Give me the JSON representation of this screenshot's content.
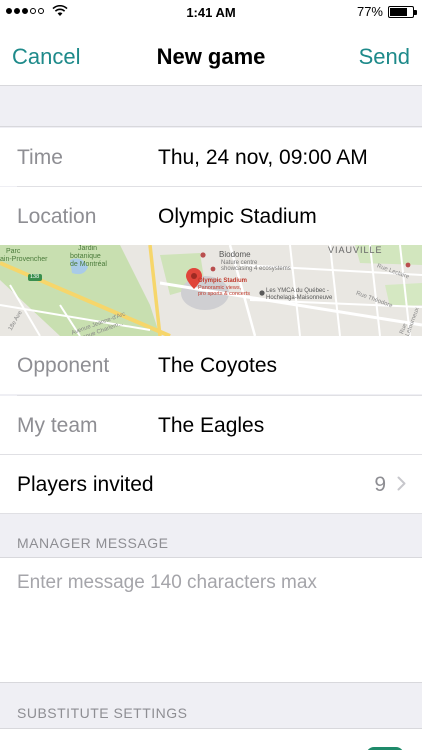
{
  "status_bar": {
    "time": "1:41 AM",
    "battery_percent": "77%",
    "battery_level": 0.77,
    "signal_dots_filled": 3
  },
  "nav": {
    "cancel_label": "Cancel",
    "title": "New game",
    "send_label": "Send"
  },
  "accent_color": "#1e8a8a",
  "form": {
    "time": {
      "label": "Time",
      "value": "Thu, 24 nov, 09:00 AM"
    },
    "location": {
      "label": "Location",
      "value": "Olympic Stadium"
    },
    "opponent": {
      "label": "Opponent",
      "value": "The Coyotes"
    },
    "my_team": {
      "label": "My team",
      "value": "The Eagles"
    },
    "players_invited": {
      "label": "Players invited",
      "count": "9"
    }
  },
  "map": {
    "labels": {
      "district": "VIAUVILLE",
      "garden_1": "Jardin",
      "garden_2": "botanique",
      "garden_3": "de Montréal",
      "park_1": "Parc",
      "park_2": "ain-Provencher",
      "biodome": "Biodome",
      "biodome_sub_1": "Nature centre",
      "biodome_sub_2": "showcasing 4 ecosystems",
      "stadium": "Olympic Stadium",
      "stadium_sub_1": "Panoramic views,",
      "stadium_sub_2": "pro sports & concerts",
      "ymca_1": "Les YMCA du Québec -",
      "ymca_2": "Hochelaga-Maisonneuve",
      "route": "138",
      "street_1": "Avenue Jeanne-d'Arc",
      "street_2": "Avenue Charlem...",
      "street_3": "Rue Théodore",
      "street_4": "Rue Leclaire",
      "street_5": "18e Ave",
      "street_6": "Rue Letourneux"
    }
  },
  "manager_message": {
    "header": "MANAGER MESSAGE",
    "placeholder": "Enter message 140 characters max"
  },
  "substitute_settings": {
    "header": "SUBSTITUTE SETTINGS"
  }
}
